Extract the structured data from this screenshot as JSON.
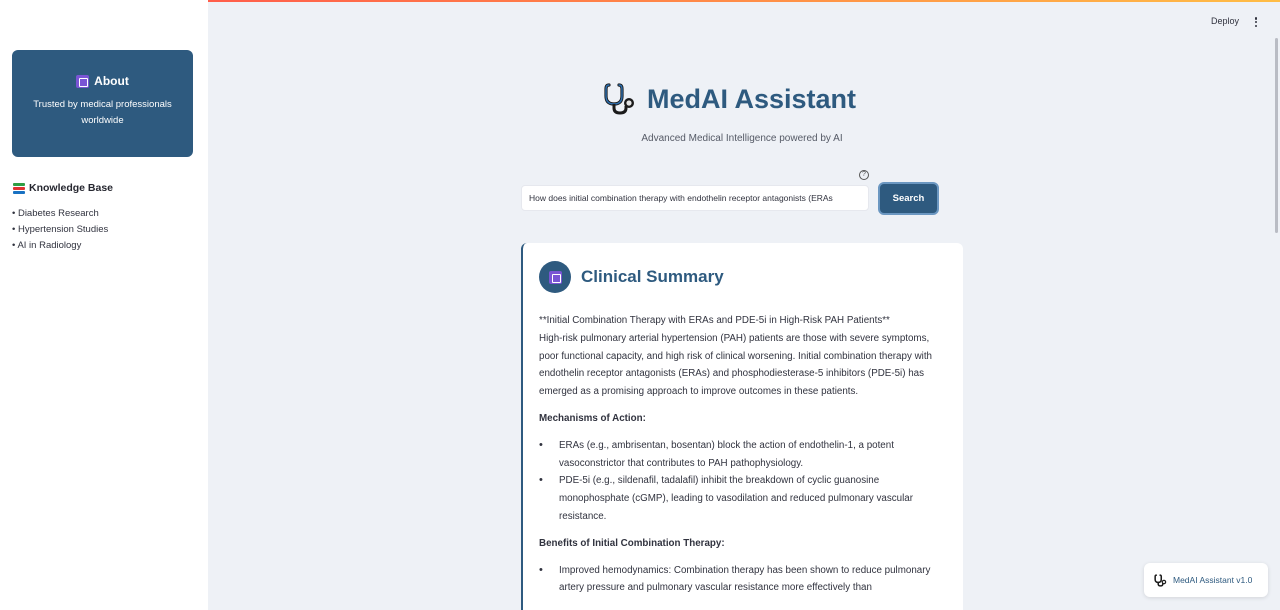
{
  "app": {
    "title": "MedAI Assistant",
    "subtitle": "Advanced Medical Intelligence powered by AI"
  },
  "toolbar": {
    "deploy_label": "Deploy"
  },
  "sidebar": {
    "about_title": "About",
    "about_text": "Trusted by medical professionals worldwide",
    "kb_title": "Knowledge Base",
    "kb_items": [
      "• Diabetes Research",
      "• Hypertension Studies",
      "• AI in Radiology"
    ]
  },
  "search": {
    "value": "How does initial combination therapy with endothelin receptor antagonists (ERAs",
    "button_label": "Search",
    "help": "?"
  },
  "summary": {
    "title": "Clinical Summary",
    "intro_heading": "**Initial Combination Therapy with ERAs and PDE-5i in High-Risk PAH Patients**",
    "intro": "High-risk pulmonary arterial hypertension (PAH) patients are those with severe symptoms, poor functional capacity, and high risk of clinical worsening. Initial combination therapy with endothelin receptor antagonists (ERAs) and phosphodiesterase-5 inhibitors (PDE-5i) has emerged as a promising approach to improve outcomes in these patients.",
    "mech_heading": "Mechanisms of Action:",
    "mech_items": [
      "ERAs (e.g., ambrisentan, bosentan) block the action of endothelin-1, a potent vasoconstrictor that contributes to PAH pathophysiology.",
      "PDE-5i (e.g., sildenafil, tadalafil) inhibit the breakdown of cyclic guanosine monophosphate (cGMP), leading to vasodilation and reduced pulmonary vascular resistance."
    ],
    "benefits_heading": "Benefits of Initial Combination Therapy:",
    "benefit_items": [
      "Improved hemodynamics: Combination therapy has been shown to reduce pulmonary artery pressure and pulmonary vascular resistance more effectively than"
    ]
  },
  "footer": {
    "version": "MedAI Assistant v1.0"
  },
  "colors": {
    "accent": "#2e5a7f",
    "background": "#eef1f6",
    "icon_purple": "#7a55d4"
  }
}
